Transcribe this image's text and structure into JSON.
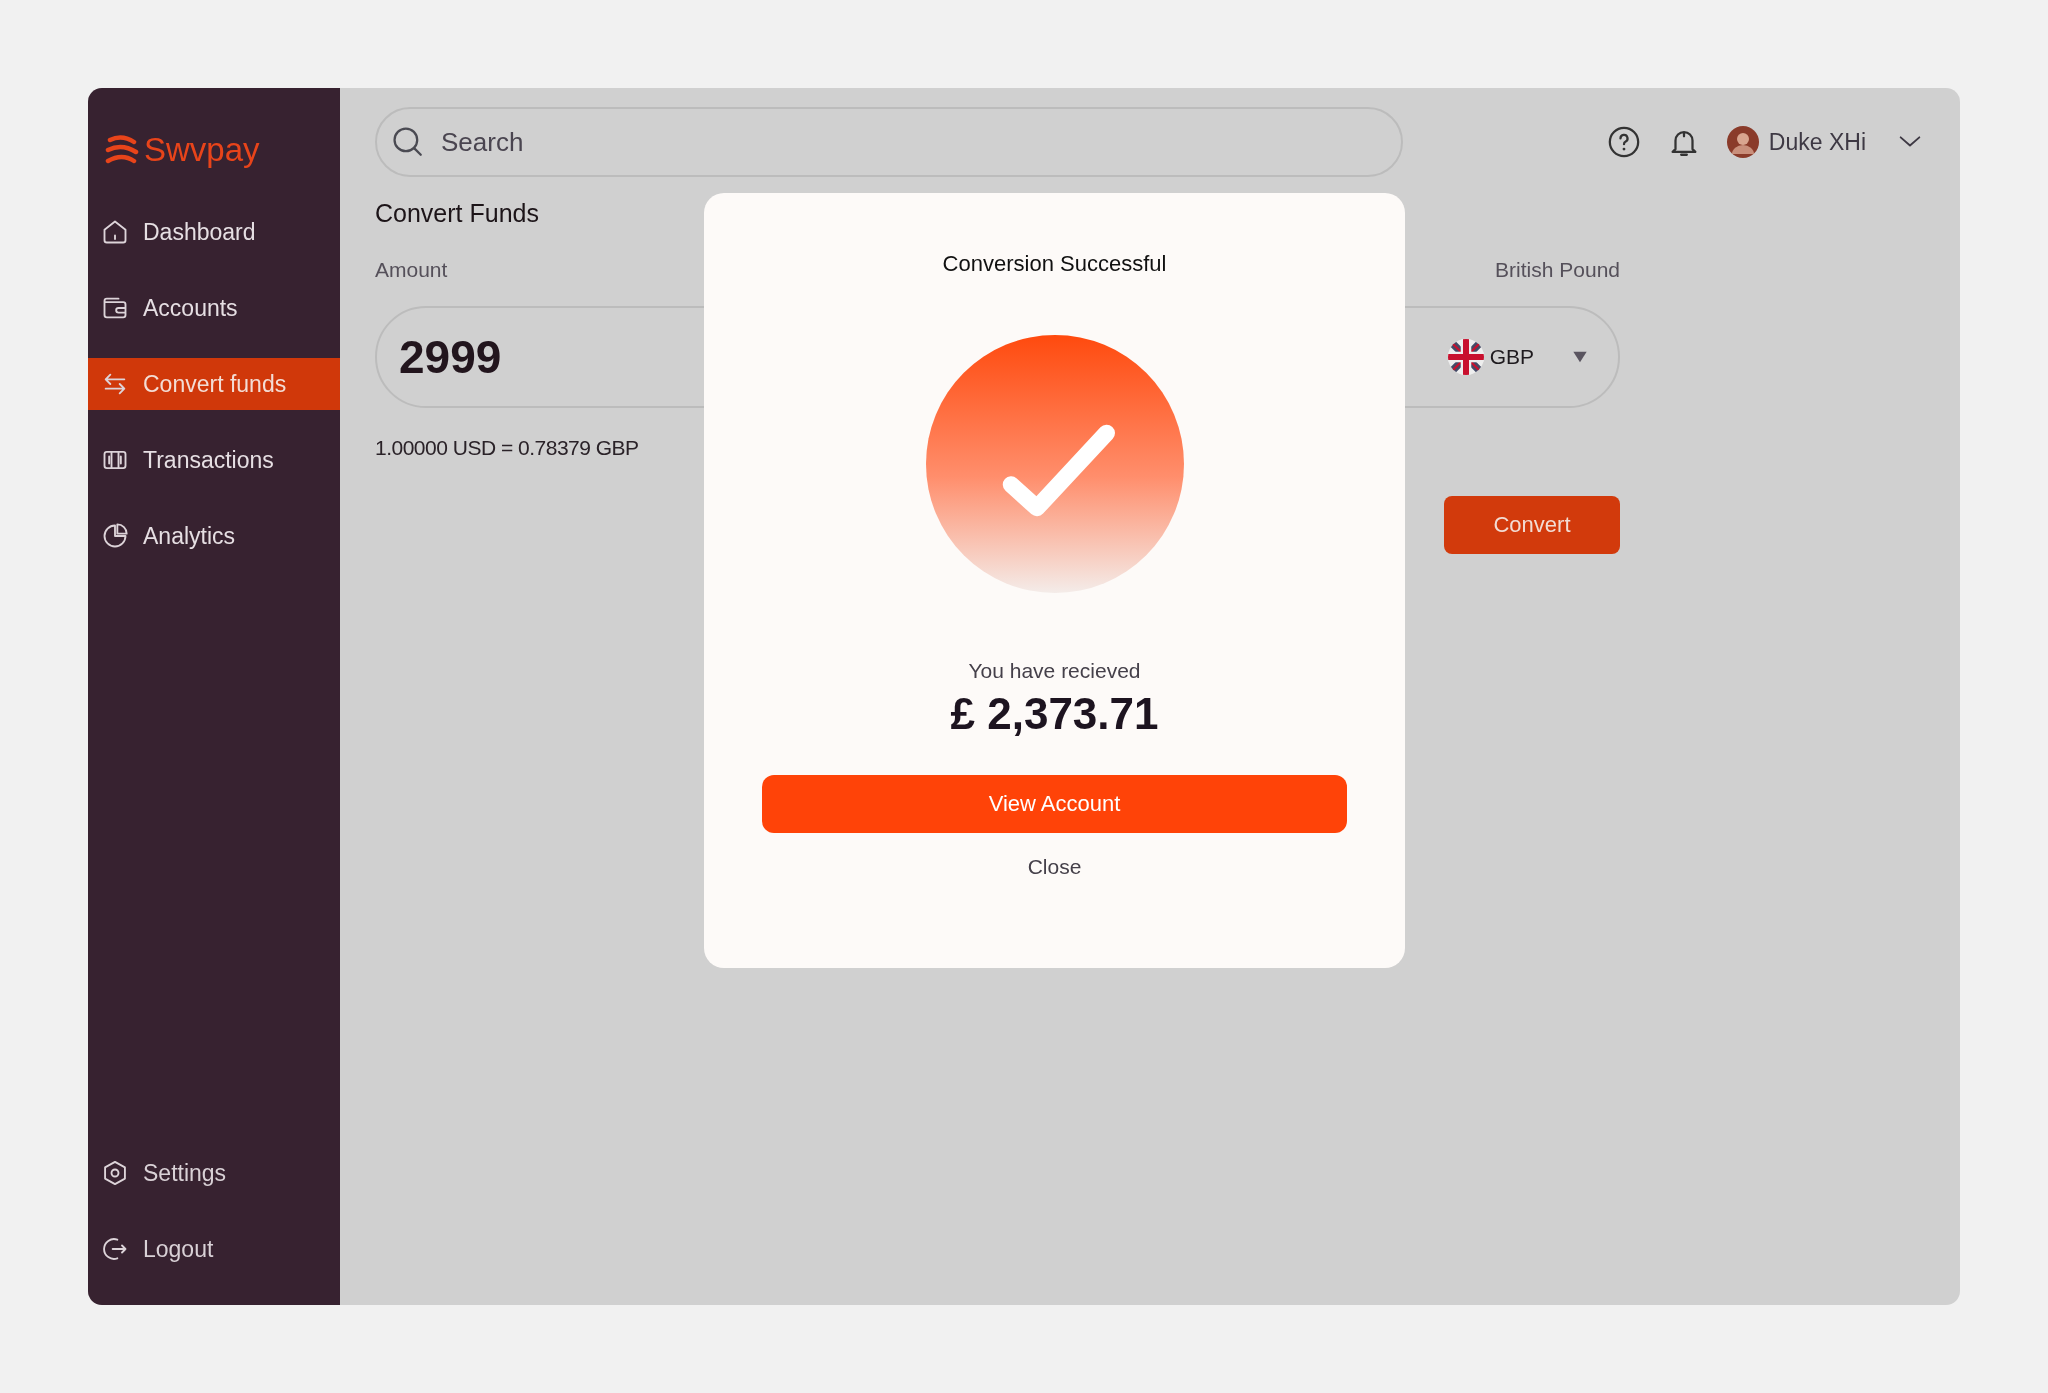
{
  "sidebar": {
    "logo": "Swvpay",
    "items": [
      {
        "label": "Dashboard",
        "selected": false
      },
      {
        "label": "Accounts",
        "selected": false
      },
      {
        "label": "Convert funds",
        "selected": true
      },
      {
        "label": "Transactions",
        "selected": false
      },
      {
        "label": "Analytics",
        "selected": false
      }
    ],
    "footer_items": [
      {
        "label": "Settings"
      },
      {
        "label": "Logout"
      }
    ]
  },
  "top_bar": {
    "search": {
      "placeholder": "Search"
    },
    "user": {
      "name": "Duke XHi"
    }
  },
  "page": {
    "title": "Convert Funds",
    "amount_label": "Amount",
    "amount": "2999",
    "currency_label": "British Pound",
    "currency": "GBP",
    "rate": "1.00000 USD = 0.78379 GBP",
    "convert_button": "Convert"
  },
  "dialog": {
    "title": "Conversion Successful",
    "message": "You have recieved",
    "amount": "£ 2,373.71",
    "primary_button": "View Account",
    "secondary_button": "Close"
  }
}
